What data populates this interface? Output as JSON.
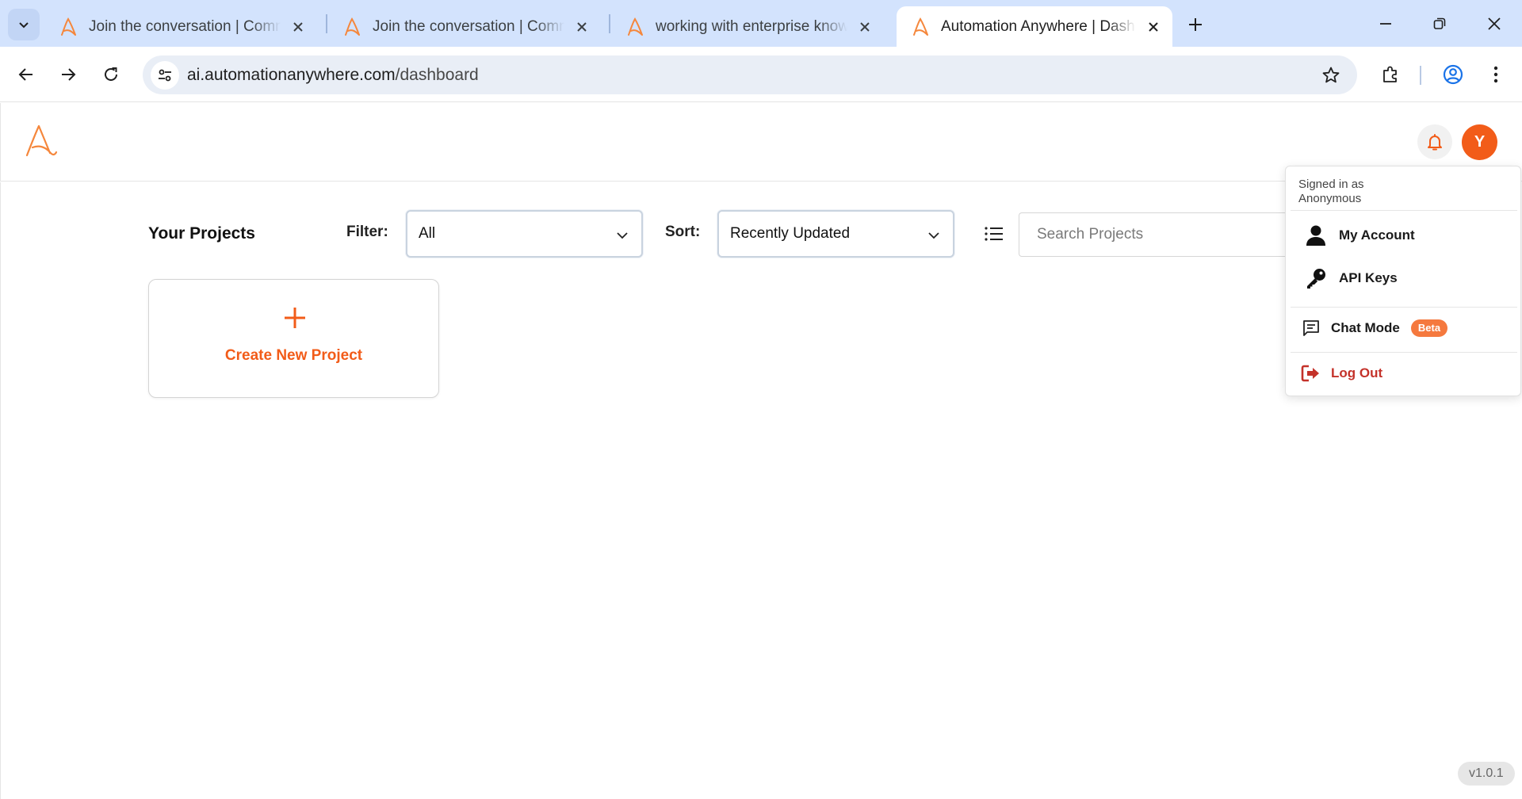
{
  "browser": {
    "tabs": [
      {
        "title": "Join the conversation | Community",
        "active": false
      },
      {
        "title": "Join the conversation | Community",
        "active": false
      },
      {
        "title": "working with enterprise knowledge",
        "active": false
      },
      {
        "title": "Automation Anywhere | Dashboard",
        "active": true
      }
    ],
    "url_host": "ai.automationanywhere.com",
    "url_path": "/dashboard"
  },
  "header": {
    "avatar_initial": "Y"
  },
  "projects": {
    "title": "Your Projects",
    "filter_label": "Filter:",
    "filter_value": "All",
    "sort_label": "Sort:",
    "sort_value": "Recently Updated",
    "search_placeholder": "Search Projects",
    "create_label": "Create New Project"
  },
  "user_menu": {
    "signed_in_line1": "Signed in as",
    "signed_in_line2": "Anonymous",
    "my_account": "My Account",
    "api_keys": "API Keys",
    "chat_mode": "Chat Mode",
    "beta": "Beta",
    "logout": "Log Out"
  },
  "version": "v1.0.1",
  "colors": {
    "brand_orange": "#f25c19",
    "tabstrip_bg": "#d3e3fd",
    "logout_red": "#c4322a"
  }
}
